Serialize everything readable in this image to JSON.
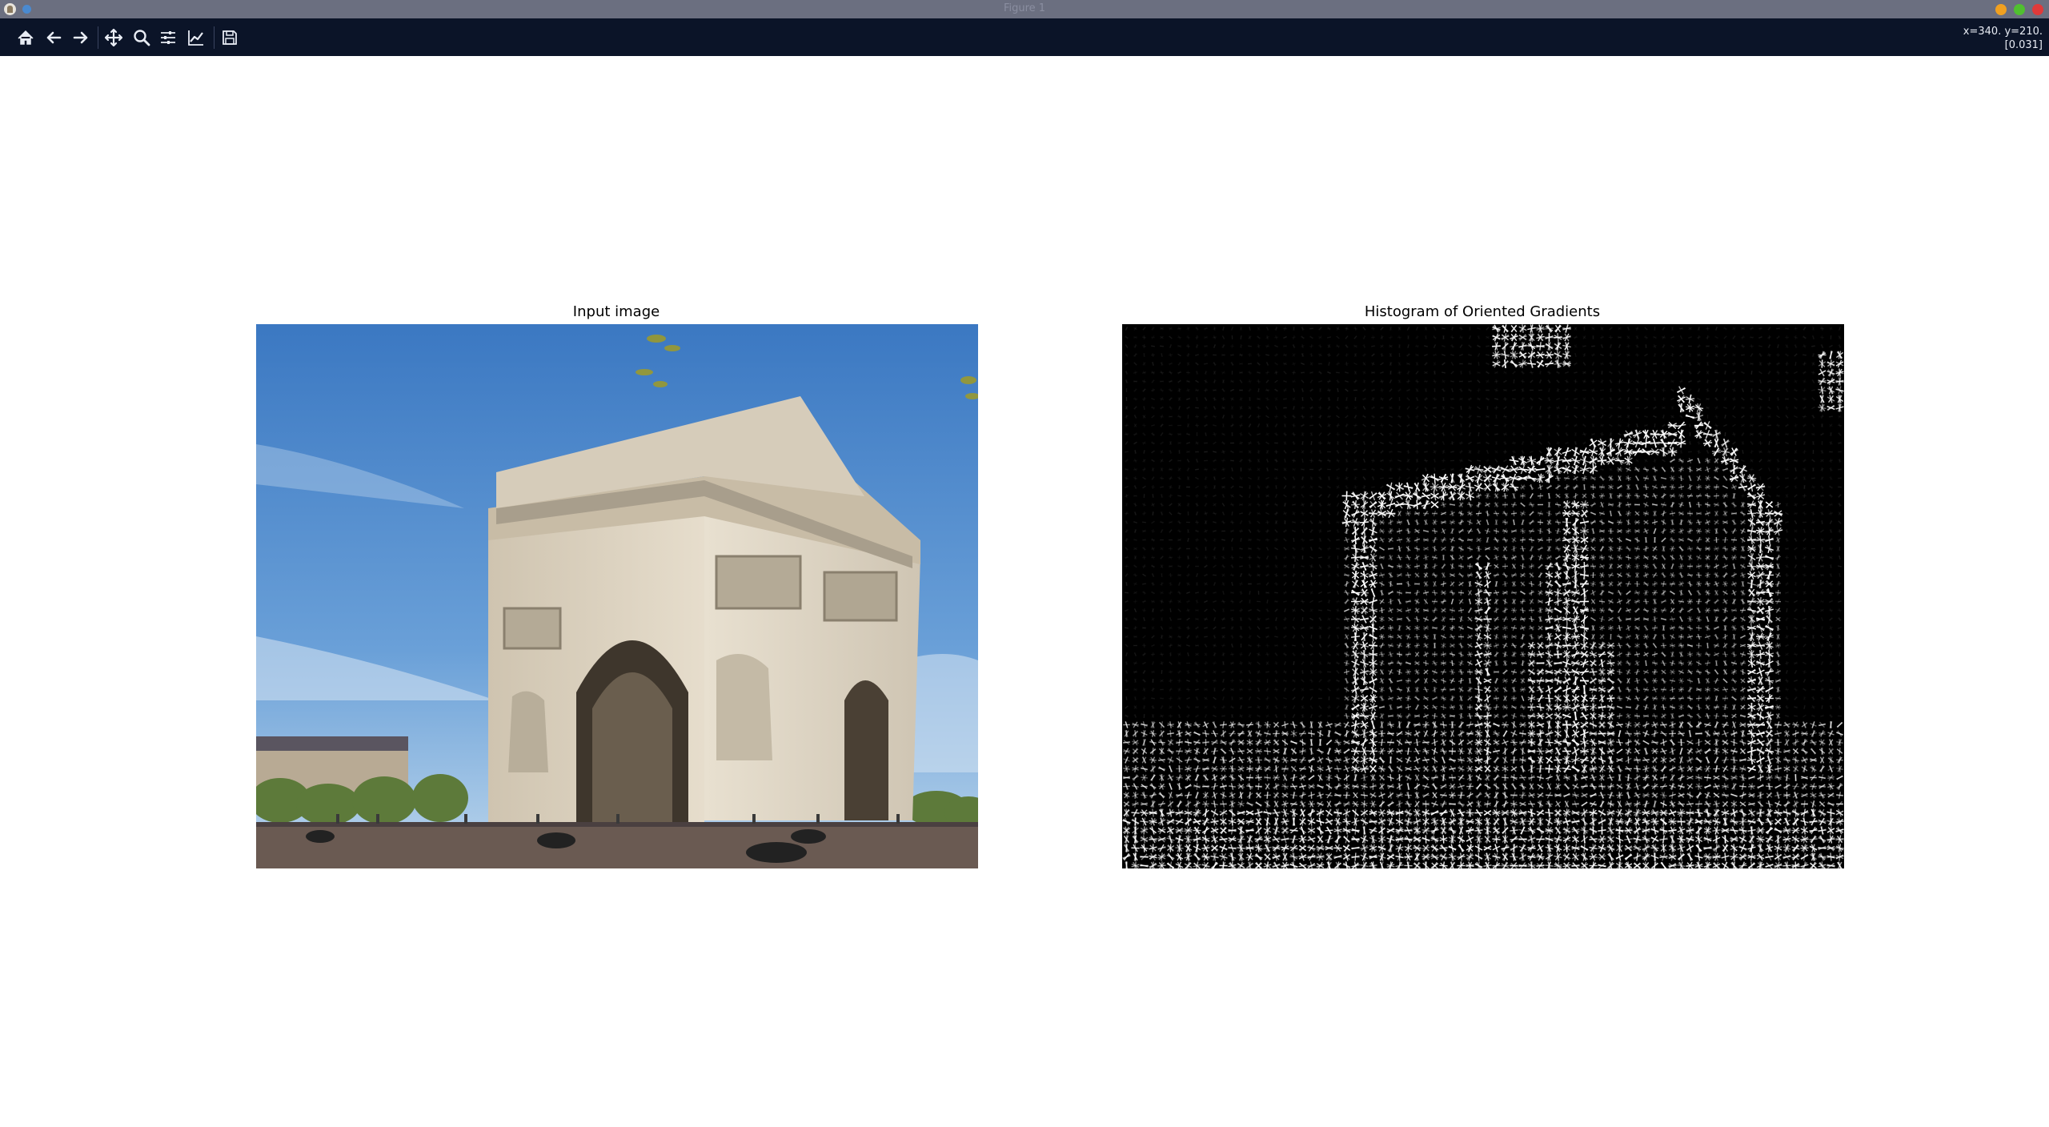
{
  "window": {
    "title": "Figure 1"
  },
  "toolbar": {
    "buttons": [
      {
        "icon": "home-icon",
        "tooltip": "Reset original view"
      },
      {
        "icon": "back-arrow-icon",
        "tooltip": "Back to previous view"
      },
      {
        "icon": "forward-arrow-icon",
        "tooltip": "Forward to next view"
      },
      {
        "icon": "pan-icon",
        "tooltip": "Pan axes"
      },
      {
        "icon": "zoom-icon",
        "tooltip": "Zoom to rectangle"
      },
      {
        "icon": "subplots-icon",
        "tooltip": "Configure subplots"
      },
      {
        "icon": "edit-axes-icon",
        "tooltip": "Edit axis, curve and image parameters"
      },
      {
        "icon": "save-icon",
        "tooltip": "Save the figure"
      }
    ],
    "coords_line1": "x=340. y=210.",
    "coords_line2": "[0.031]"
  },
  "figure": {
    "left_title": "Input image",
    "right_title": "Histogram of Oriented Gradients"
  },
  "colors": {
    "titlebar": "#6b6f80",
    "toolbar": "#0b1428",
    "sky": "#4a86c8",
    "stone": "#d8cfc0",
    "hog_bg": "#000000",
    "hog_line": "#ffffff"
  }
}
